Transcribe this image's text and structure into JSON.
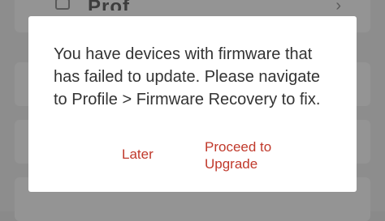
{
  "background": {
    "title": "Prof",
    "icon": "bookmark-icon",
    "chevron": "›"
  },
  "dialog": {
    "message": "You have devices with firmware that\nhas failed to update. Please navigate\nto Profile > Firmware Recovery to fix.",
    "later_label": "Later",
    "proceed_label": "Proceed to\nUpgrade"
  },
  "colors": {
    "accent": "#c0392b",
    "overlay": "#8d8d8d",
    "dialog_bg": "#ffffff",
    "text": "#333333"
  }
}
